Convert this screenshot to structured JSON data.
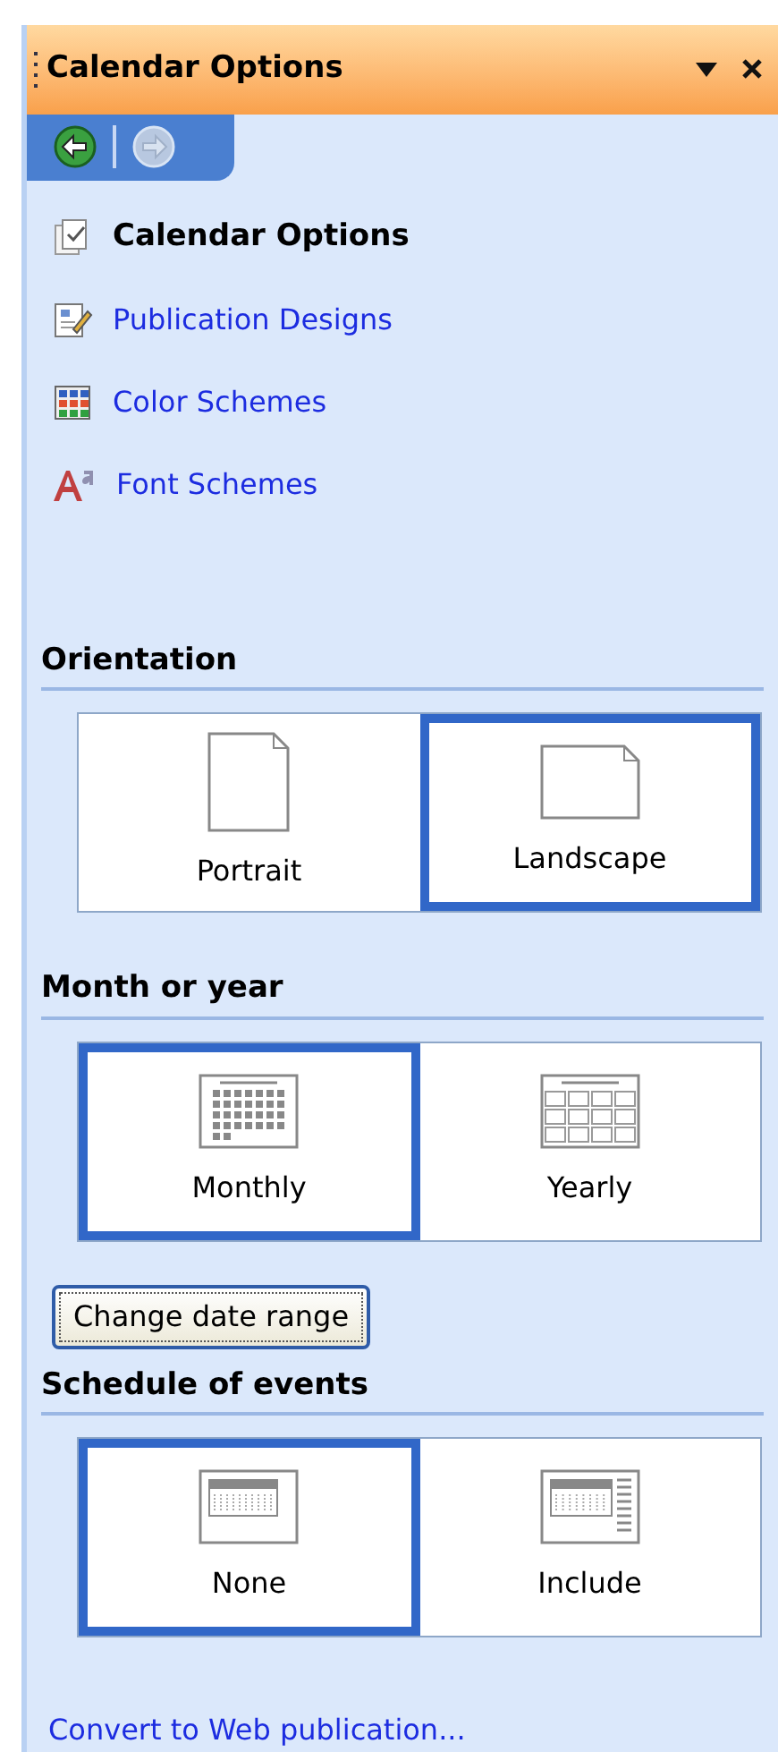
{
  "pane": {
    "title": "Calendar Options"
  },
  "nav": [
    {
      "kind": "back",
      "disabled": false
    },
    {
      "kind": "forward",
      "disabled": true
    }
  ],
  "links": [
    {
      "label": "Calendar Options",
      "kind": "options",
      "current": true
    },
    {
      "label": "Publication Designs",
      "kind": "designs",
      "current": false
    },
    {
      "label": "Color Schemes",
      "kind": "colors",
      "current": false
    },
    {
      "label": "Font Schemes",
      "kind": "fonts",
      "current": false
    }
  ],
  "sections": [
    {
      "heading": "Orientation",
      "options": [
        {
          "label": "Portrait",
          "kind": "portrait",
          "selected": false
        },
        {
          "label": "Landscape",
          "kind": "landscape",
          "selected": true
        }
      ]
    },
    {
      "heading": "Month or year",
      "options": [
        {
          "label": "Monthly",
          "kind": "monthly",
          "selected": true
        },
        {
          "label": "Yearly",
          "kind": "yearly",
          "selected": false
        }
      ],
      "button": "Change date range"
    },
    {
      "heading": "Schedule of events",
      "options": [
        {
          "label": "None",
          "kind": "none",
          "selected": true
        },
        {
          "label": "Include",
          "kind": "include",
          "selected": false
        }
      ]
    }
  ],
  "footer_link": "Convert to Web publication..."
}
